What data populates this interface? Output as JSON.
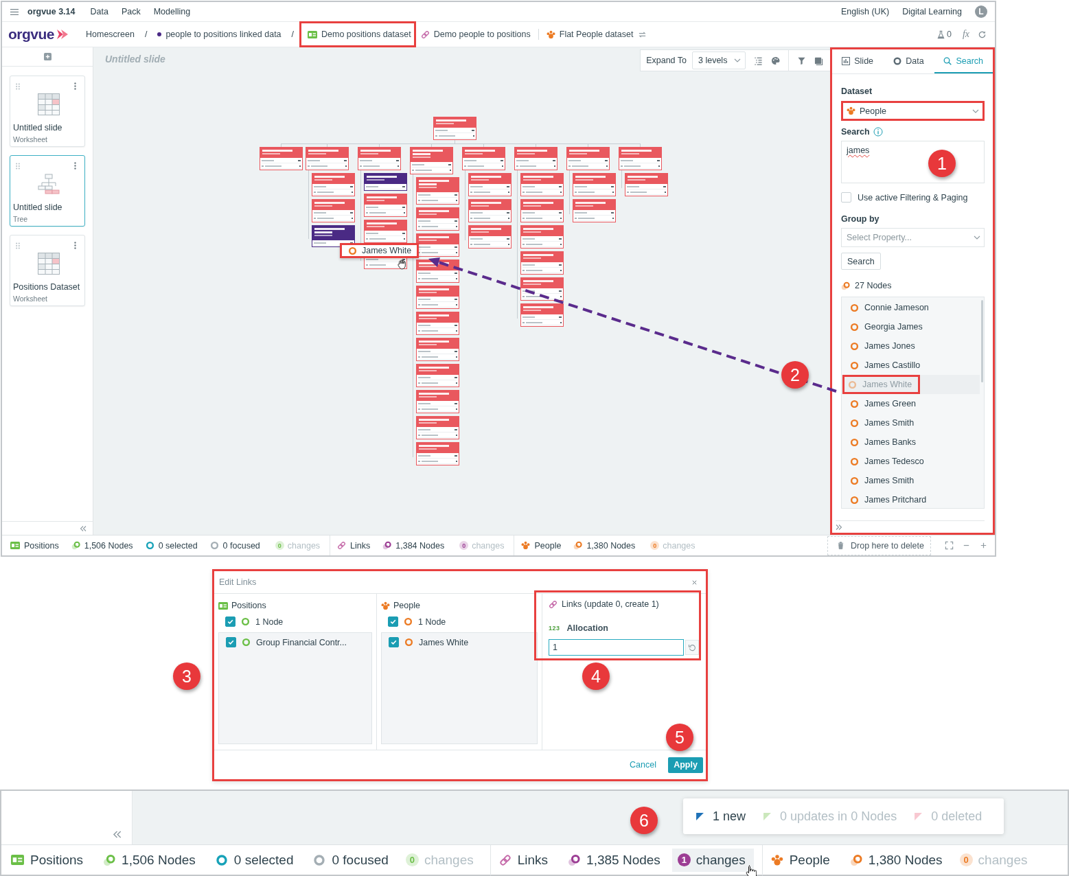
{
  "menu_bar": {
    "app_title": "orgvue 3.14",
    "menus": [
      "Data",
      "Pack",
      "Modelling"
    ],
    "language": "English (UK)",
    "user": "Digital Learning",
    "avatar_initial": "L"
  },
  "breadcrumb": {
    "logo": "orgvue",
    "items": [
      {
        "kind": "home",
        "label": "Homescreen",
        "highlighted": false
      },
      {
        "kind": "linked",
        "separator": "/",
        "label": "people to positions linked data",
        "highlighted": false
      },
      {
        "kind": "positions",
        "separator": "/",
        "label": "Demo positions dataset",
        "highlighted": true
      },
      {
        "kind": "links",
        "label": "Demo people to positions",
        "highlighted": false
      },
      {
        "kind": "people",
        "label": "Flat People dataset",
        "highlighted": false
      }
    ],
    "flask_count": "0",
    "formula_label": "fx"
  },
  "sidebar": {
    "slides": [
      {
        "kind": "worksheet",
        "title": "Untitled slide",
        "type_label": "Worksheet",
        "selected": false
      },
      {
        "kind": "tree",
        "title": "Untitled slide",
        "type_label": "Tree",
        "selected": true
      },
      {
        "kind": "worksheet",
        "title": "Positions Dataset",
        "type_label": "Worksheet",
        "selected": false
      }
    ]
  },
  "canvas": {
    "title_placeholder": "Untitled slide",
    "expand_label": "Expand To",
    "expand_levels": "3 levels",
    "callout": "2",
    "drag_chip": {
      "label": "James White",
      "highlighted": true
    },
    "tree": {
      "kind": "standard",
      "vacant": false,
      "children": [
        {
          "kind": "standard",
          "vacant": false
        },
        {
          "kind": "standard",
          "vacant": false,
          "children": [
            {
              "kind": "standard",
              "vacant": false
            },
            {
              "kind": "standard",
              "vacant": false
            },
            {
              "kind": "long_title",
              "vacant": true
            }
          ]
        },
        {
          "kind": "standard",
          "vacant": false,
          "children": [
            {
              "kind": "standard",
              "vacant": true
            },
            {
              "kind": "standard",
              "vacant": false
            },
            {
              "kind": "standard",
              "vacant": false
            },
            {
              "kind": "standard",
              "vacant": false
            }
          ]
        },
        {
          "kind": "long_title",
          "vacant": false,
          "children": [
            {
              "kind": "long_title",
              "vacant": false
            },
            {
              "kind": "standard",
              "vacant": false
            },
            {
              "kind": "standard",
              "vacant": false
            },
            {
              "kind": "standard",
              "vacant": false
            },
            {
              "kind": "standard",
              "vacant": false
            },
            {
              "kind": "standard",
              "vacant": false
            },
            {
              "kind": "standard",
              "vacant": false
            },
            {
              "kind": "standard",
              "vacant": false
            },
            {
              "kind": "standard",
              "vacant": false
            },
            {
              "kind": "standard",
              "vacant": false
            },
            {
              "kind": "standard",
              "vacant": false
            }
          ]
        },
        {
          "kind": "standard",
          "vacant": false,
          "children": [
            {
              "kind": "standard",
              "vacant": false
            },
            {
              "kind": "standard",
              "vacant": false
            },
            {
              "kind": "standard",
              "vacant": false
            }
          ]
        },
        {
          "kind": "standard",
          "vacant": false,
          "children": [
            {
              "kind": "standard",
              "vacant": false
            },
            {
              "kind": "standard",
              "vacant": false
            },
            {
              "kind": "standard",
              "vacant": false
            },
            {
              "kind": "standard",
              "vacant": false
            },
            {
              "kind": "standard",
              "vacant": false
            },
            {
              "kind": "standard",
              "vacant": false
            }
          ]
        },
        {
          "kind": "standard",
          "vacant": false,
          "children": [
            {
              "kind": "standard",
              "vacant": false
            },
            {
              "kind": "standard",
              "vacant": false
            }
          ]
        },
        {
          "kind": "standard",
          "vacant": false,
          "children": [
            {
              "kind": "standard",
              "vacant": false
            }
          ]
        }
      ]
    }
  },
  "side_panel": {
    "highlighted": true,
    "callout": "1",
    "tabs": [
      {
        "kind": "slide",
        "label": "Slide",
        "selected": false
      },
      {
        "kind": "data",
        "label": "Data",
        "selected": false
      },
      {
        "kind": "search",
        "label": "Search",
        "selected": true
      }
    ],
    "dataset_label": "Dataset",
    "dataset": {
      "value": "People",
      "highlighted": true
    },
    "search_label": "Search",
    "search_query": "james",
    "filter_option": {
      "label": "Use active Filtering & Paging",
      "checked": false
    },
    "group_by_label": "Group by",
    "group_by": {
      "placeholder": "Select Property..."
    },
    "search_button": "Search",
    "result_count": "27 Nodes",
    "results": [
      {
        "label": "Connie Jameson",
        "dragging": false,
        "highlighted": false
      },
      {
        "label": "Georgia James",
        "dragging": false,
        "highlighted": false
      },
      {
        "label": "James Jones",
        "dragging": false,
        "highlighted": false
      },
      {
        "label": "James Castillo",
        "dragging": false,
        "highlighted": false
      },
      {
        "label": "James White",
        "dragging": true,
        "highlighted": true
      },
      {
        "label": "James Green",
        "dragging": false,
        "highlighted": false
      },
      {
        "label": "James Smith",
        "dragging": false,
        "highlighted": false
      },
      {
        "label": "James Banks",
        "dragging": false,
        "highlighted": false
      },
      {
        "label": "James Tedesco",
        "dragging": false,
        "highlighted": false
      },
      {
        "label": "James Smith",
        "dragging": false,
        "highlighted": false
      },
      {
        "label": "James Pritchard",
        "dragging": false,
        "highlighted": false
      }
    ]
  },
  "status_bar": {
    "groups": [
      {
        "kind": "positions",
        "label": "Positions",
        "nodes": "1,506 Nodes",
        "selected": "0 selected",
        "focused": "0 focused",
        "changes": {
          "count": "0",
          "label": "changes",
          "active": false,
          "hovered": false
        }
      },
      {
        "kind": "links",
        "label": "Links",
        "nodes": "1,384 Nodes",
        "changes": {
          "count": "0",
          "label": "changes",
          "active": false,
          "hovered": false
        }
      },
      {
        "kind": "people",
        "label": "People",
        "nodes": "1,380 Nodes",
        "changes": {
          "count": "0",
          "label": "changes",
          "active": false,
          "hovered": false
        }
      }
    ],
    "delete_zone": "Drop here to delete"
  },
  "edit_links_dialog": {
    "callout": "3",
    "title": "Edit Links",
    "highlighted": true,
    "columns": [
      {
        "kind": "positions",
        "title": "Positions",
        "count": {
          "label": "1 Node",
          "checked": true
        },
        "items": [
          {
            "label": "Group Financial Contr...",
            "checked": true
          }
        ]
      },
      {
        "kind": "people",
        "title": "People",
        "count": {
          "label": "1 Node",
          "checked": true
        },
        "items": [
          {
            "label": "James White",
            "checked": true
          }
        ]
      }
    ],
    "links": {
      "title": "Links (update 0, create 1)",
      "highlighted": true,
      "callout": "4",
      "type_label": "123",
      "property": "Allocation",
      "value": "1"
    },
    "cancel": "Cancel",
    "apply": "Apply",
    "apply_callout": "5"
  },
  "zoomed_status": {
    "callout": "6",
    "popover": [
      {
        "kind": "new",
        "label": "1 new",
        "active": true
      },
      {
        "kind": "updated",
        "label": "0 updates in 0 Nodes",
        "active": false
      },
      {
        "kind": "deleted",
        "label": "0 deleted",
        "active": false
      }
    ],
    "status_bar": {
      "groups": [
        {
          "kind": "positions",
          "label": "Positions",
          "nodes": "1,506 Nodes",
          "selected": "0 selected",
          "focused": "0 focused",
          "changes": {
            "count": "0",
            "label": "changes",
            "active": false,
            "hovered": false
          }
        },
        {
          "kind": "links",
          "label": "Links",
          "nodes": "1,385 Nodes",
          "changes": {
            "count": "1",
            "label": "changes",
            "active": true,
            "hovered": true
          }
        },
        {
          "kind": "people",
          "label": "People",
          "nodes": "1,380 Nodes",
          "changes": {
            "count": "0",
            "label": "changes",
            "active": false,
            "hovered": false
          }
        }
      ]
    }
  }
}
